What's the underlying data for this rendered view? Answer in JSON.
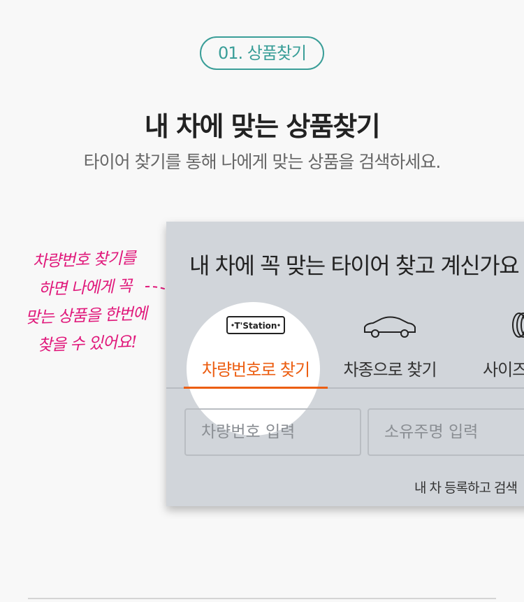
{
  "step_badge": "01. 상품찾기",
  "heading": "내 차에 맞는 상품찾기",
  "subheading": "타이어 찾기를 통해 나에게 맞는 상품을 검색하세요.",
  "note_lines": [
    "차량번호 찾기를",
    "하면 나에게 꼭",
    "맞는 상품을 한번에",
    "찾을 수 있어요!"
  ],
  "panel": {
    "title": "내 차에 꼭 맞는 타이어 찾고 계신가요",
    "tabs": [
      {
        "label": "차량번호로 찾기",
        "icon": "tstation-plate-icon",
        "active": true
      },
      {
        "label": "차종으로 찾기",
        "icon": "car-icon",
        "active": false
      },
      {
        "label": "사이즈",
        "icon": "tire-icon",
        "active": false
      }
    ],
    "plate_text": "T'Station",
    "inputs": {
      "plate_placeholder": "차량번호 입력",
      "owner_placeholder": "소유주명 입력"
    },
    "register_link": "내 차 등록하고 검색"
  },
  "colors": {
    "accent_teal": "#3a9e98",
    "note_pink": "#e0177a",
    "active_orange": "#ec5e12",
    "panel_bg": "#d1d5da"
  }
}
